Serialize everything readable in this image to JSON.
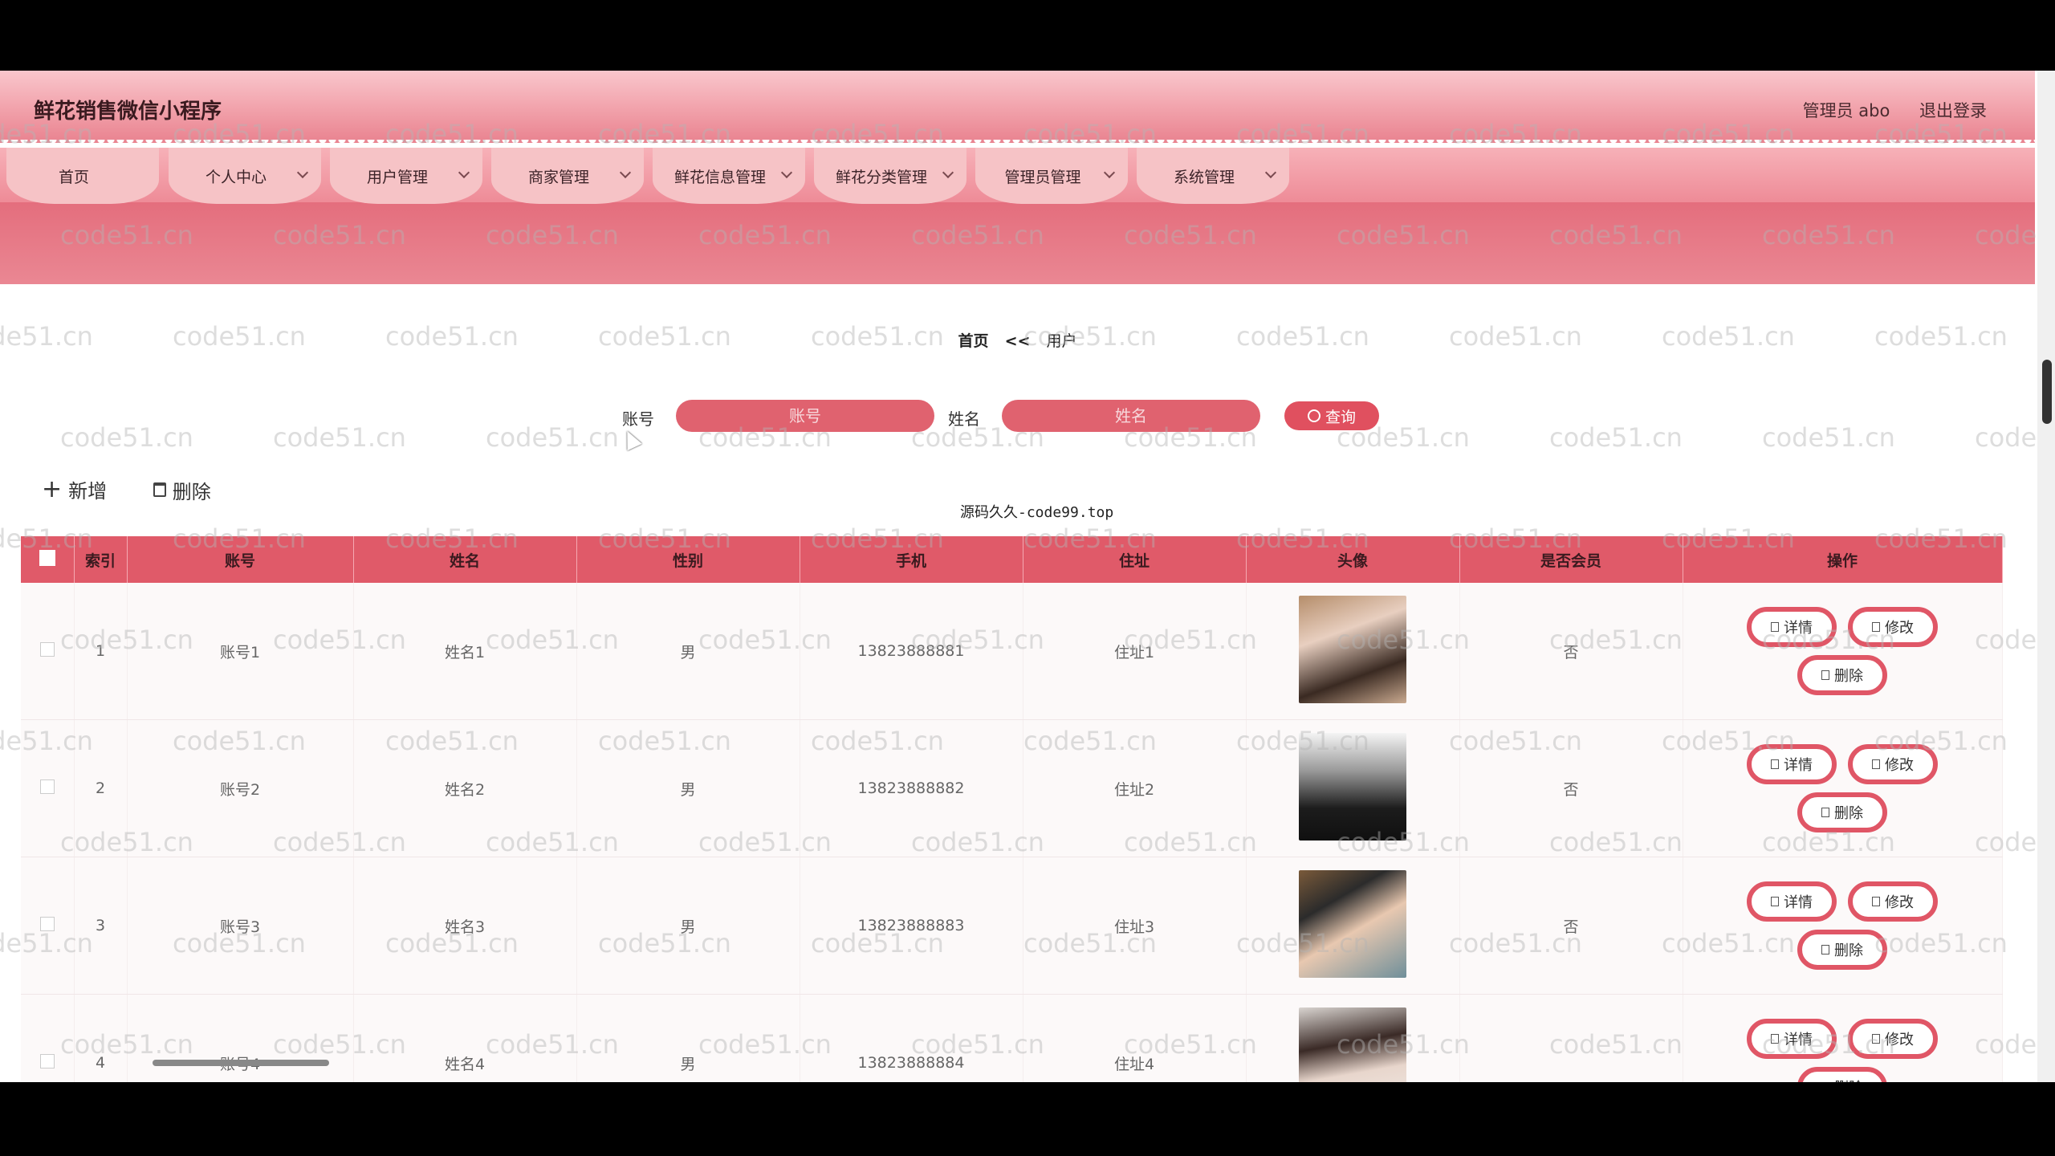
{
  "header": {
    "app_title": "鲜花销售微信小程序",
    "user_label": "管理员 abo",
    "logout": "退出登录"
  },
  "nav": [
    {
      "label": "首页",
      "has_dropdown": false
    },
    {
      "label": "个人中心",
      "has_dropdown": true
    },
    {
      "label": "用户管理",
      "has_dropdown": true
    },
    {
      "label": "商家管理",
      "has_dropdown": true
    },
    {
      "label": "鲜花信息管理",
      "has_dropdown": true
    },
    {
      "label": "鲜花分类管理",
      "has_dropdown": true
    },
    {
      "label": "管理员管理",
      "has_dropdown": true
    },
    {
      "label": "系统管理",
      "has_dropdown": true
    }
  ],
  "breadcrumb": {
    "home": "首页",
    "sep": "<<",
    "current": "用户"
  },
  "search": {
    "account_label": "账号",
    "account_placeholder": "账号",
    "name_label": "姓名",
    "name_placeholder": "姓名",
    "query_label": "查询"
  },
  "actions": {
    "add": "新增",
    "delete": "删除"
  },
  "table": {
    "headers": [
      "索引",
      "账号",
      "姓名",
      "性别",
      "手机",
      "住址",
      "头像",
      "是否会员",
      "操作"
    ],
    "rows": [
      {
        "index": "1",
        "account": "账号1",
        "name": "姓名1",
        "gender": "男",
        "phone": "13823888881",
        "address": "住址1",
        "member": "否"
      },
      {
        "index": "2",
        "account": "账号2",
        "name": "姓名2",
        "gender": "男",
        "phone": "13823888882",
        "address": "住址2",
        "member": "否"
      },
      {
        "index": "3",
        "account": "账号3",
        "name": "姓名3",
        "gender": "男",
        "phone": "13823888883",
        "address": "住址3",
        "member": "否"
      },
      {
        "index": "4",
        "account": "账号4",
        "name": "姓名4",
        "gender": "男",
        "phone": "13823888884",
        "address": "住址4",
        "member": ""
      }
    ],
    "row_buttons": {
      "detail": "详情",
      "edit": "修改",
      "delete": "删除"
    }
  },
  "overlay_text": "源码久久-code99.top",
  "watermark": "code51.cn",
  "colors": {
    "accent": "#e05a69",
    "header_pink": "#f2a4ad",
    "button_border": "#e05666"
  }
}
